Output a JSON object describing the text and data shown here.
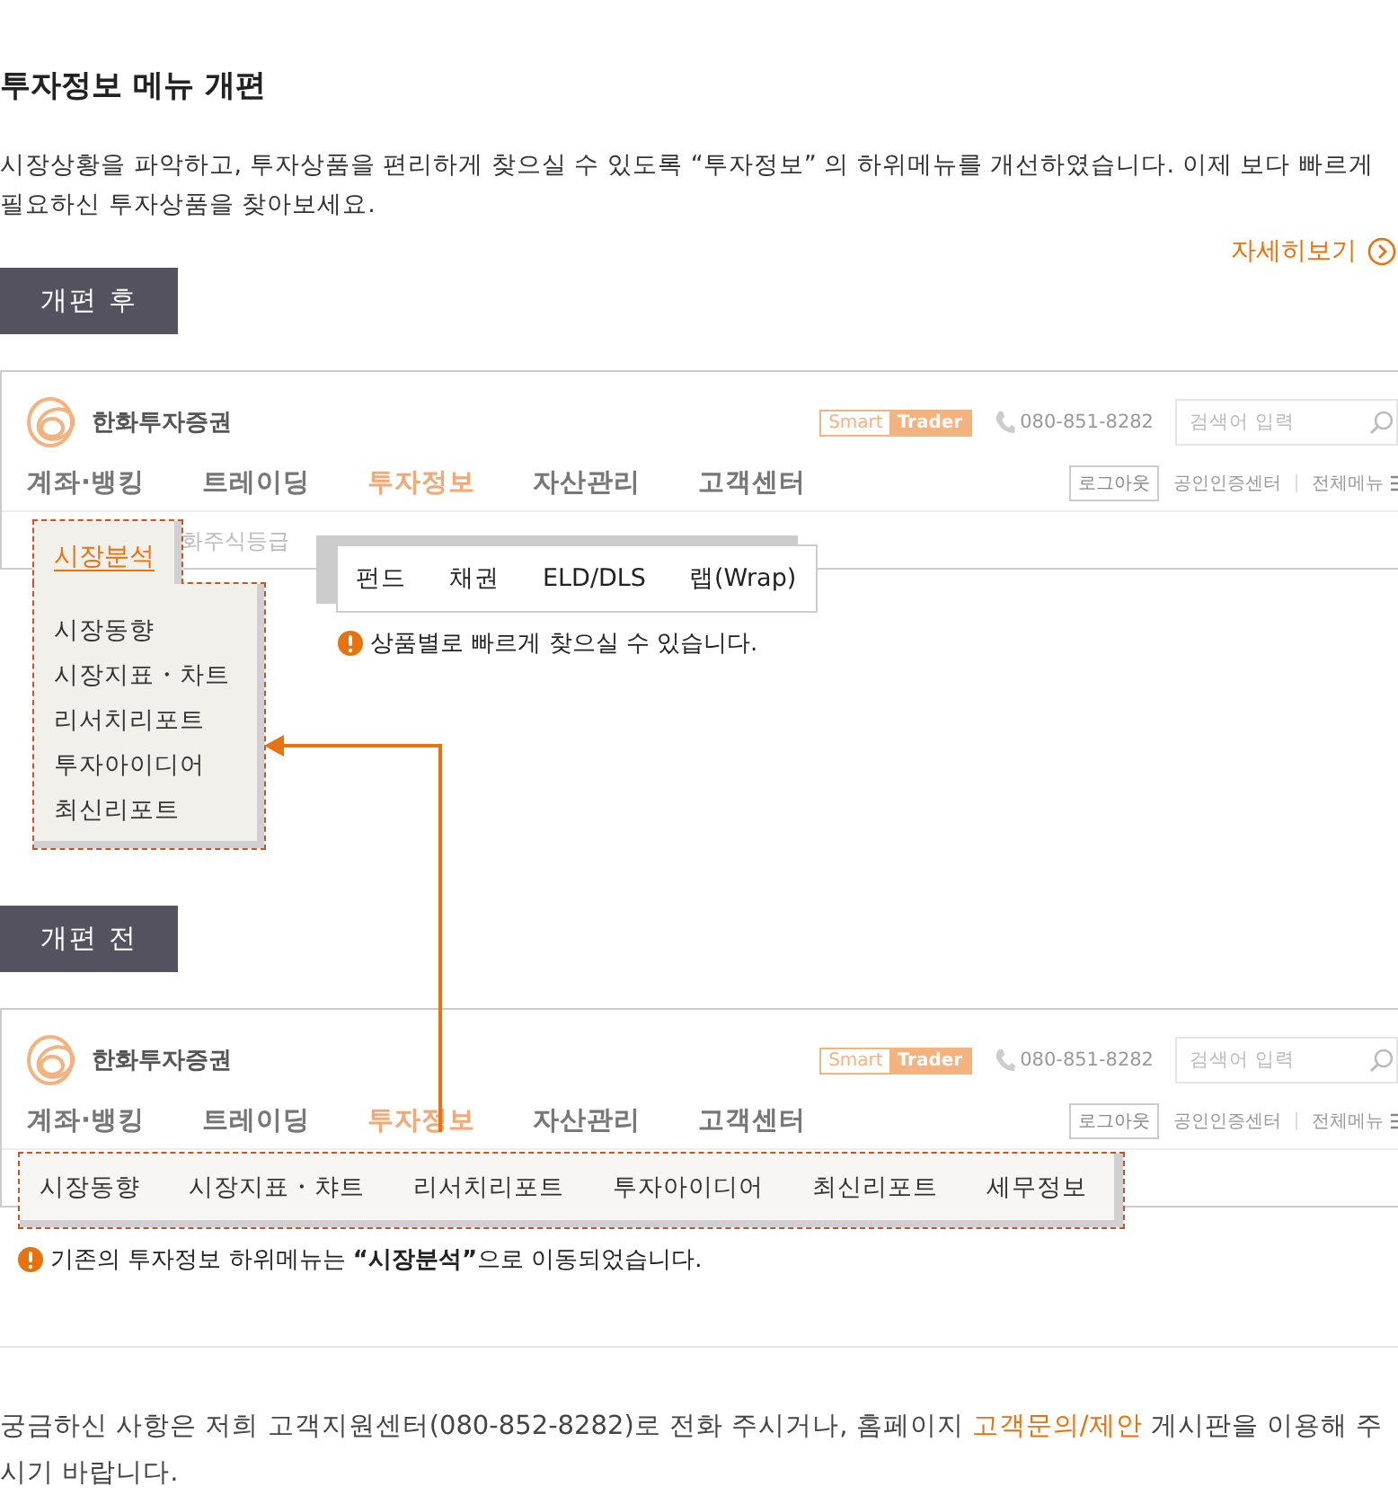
{
  "title": "투자정보 메뉴 개편",
  "intro": "시장상황을 파악하고, 투자상품을 편리하게 찾으실 수 있도록 “투자정보” 의 하위메뉴를 개선하였습니다. 이제 보다 빠르게 필요하신 투자상품을 찾아보세요.",
  "more_link": "자세히보기",
  "after": {
    "tag": "개편 후",
    "header": {
      "logo": "한화투자증권",
      "smart": "Smart",
      "trader": "Trader",
      "phone": "080-851-8282",
      "search": {
        "placeholder": "검색어 입력"
      },
      "nav": [
        {
          "label": "계좌·뱅킹",
          "selected": false
        },
        {
          "label": "트레이딩",
          "selected": false
        },
        {
          "label": "투자정보",
          "selected": true
        },
        {
          "label": "자산관리",
          "selected": false
        },
        {
          "label": "고객센터",
          "selected": false
        }
      ],
      "logout": "로그아웃",
      "links": [
        "공인인증센터",
        "전체메뉴"
      ]
    },
    "sub_row": "화주식등급",
    "menu": {
      "head": "시장분석",
      "items": [
        "시장동향",
        "시장지표・차트",
        "리서치리포트",
        "투자아이디어",
        "최신리포트"
      ]
    },
    "popup": [
      "펀드",
      "채권",
      "ELD/DLS",
      "랩(Wrap)"
    ],
    "note": "상품별로 빠르게 찾으실 수 있습니다."
  },
  "before": {
    "tag": "개편 전",
    "header": {
      "logo": "한화투자증권",
      "smart": "Smart",
      "trader": "Trader",
      "phone": "080-851-8282",
      "search": {
        "placeholder": "검색어 입력"
      },
      "nav": [
        {
          "label": "계좌·뱅킹",
          "selected": false
        },
        {
          "label": "트레이딩",
          "selected": false
        },
        {
          "label": "투자정보",
          "selected": true
        },
        {
          "label": "자산관리",
          "selected": false
        },
        {
          "label": "고객센터",
          "selected": false
        }
      ],
      "logout": "로그아웃",
      "links": [
        "공인인증센터",
        "전체메뉴"
      ]
    },
    "menu": [
      "시장동향",
      "시장지표・챠트",
      "리서치리포트",
      "투자아이디어",
      "최신리포트",
      "세무정보"
    ],
    "note": "기존의 투자정보 하위메뉴는 **“시장분석”**으로 이동되었습니다."
  },
  "contact": {
    "text": "궁금하신 사항은 저희 고객지원센터(080-852-8282)로 전화 주시거나, 홈페이지 ",
    "link": "고객문의/제안",
    "after": " 게시판을 이용해 주시기 바랍니다."
  }
}
